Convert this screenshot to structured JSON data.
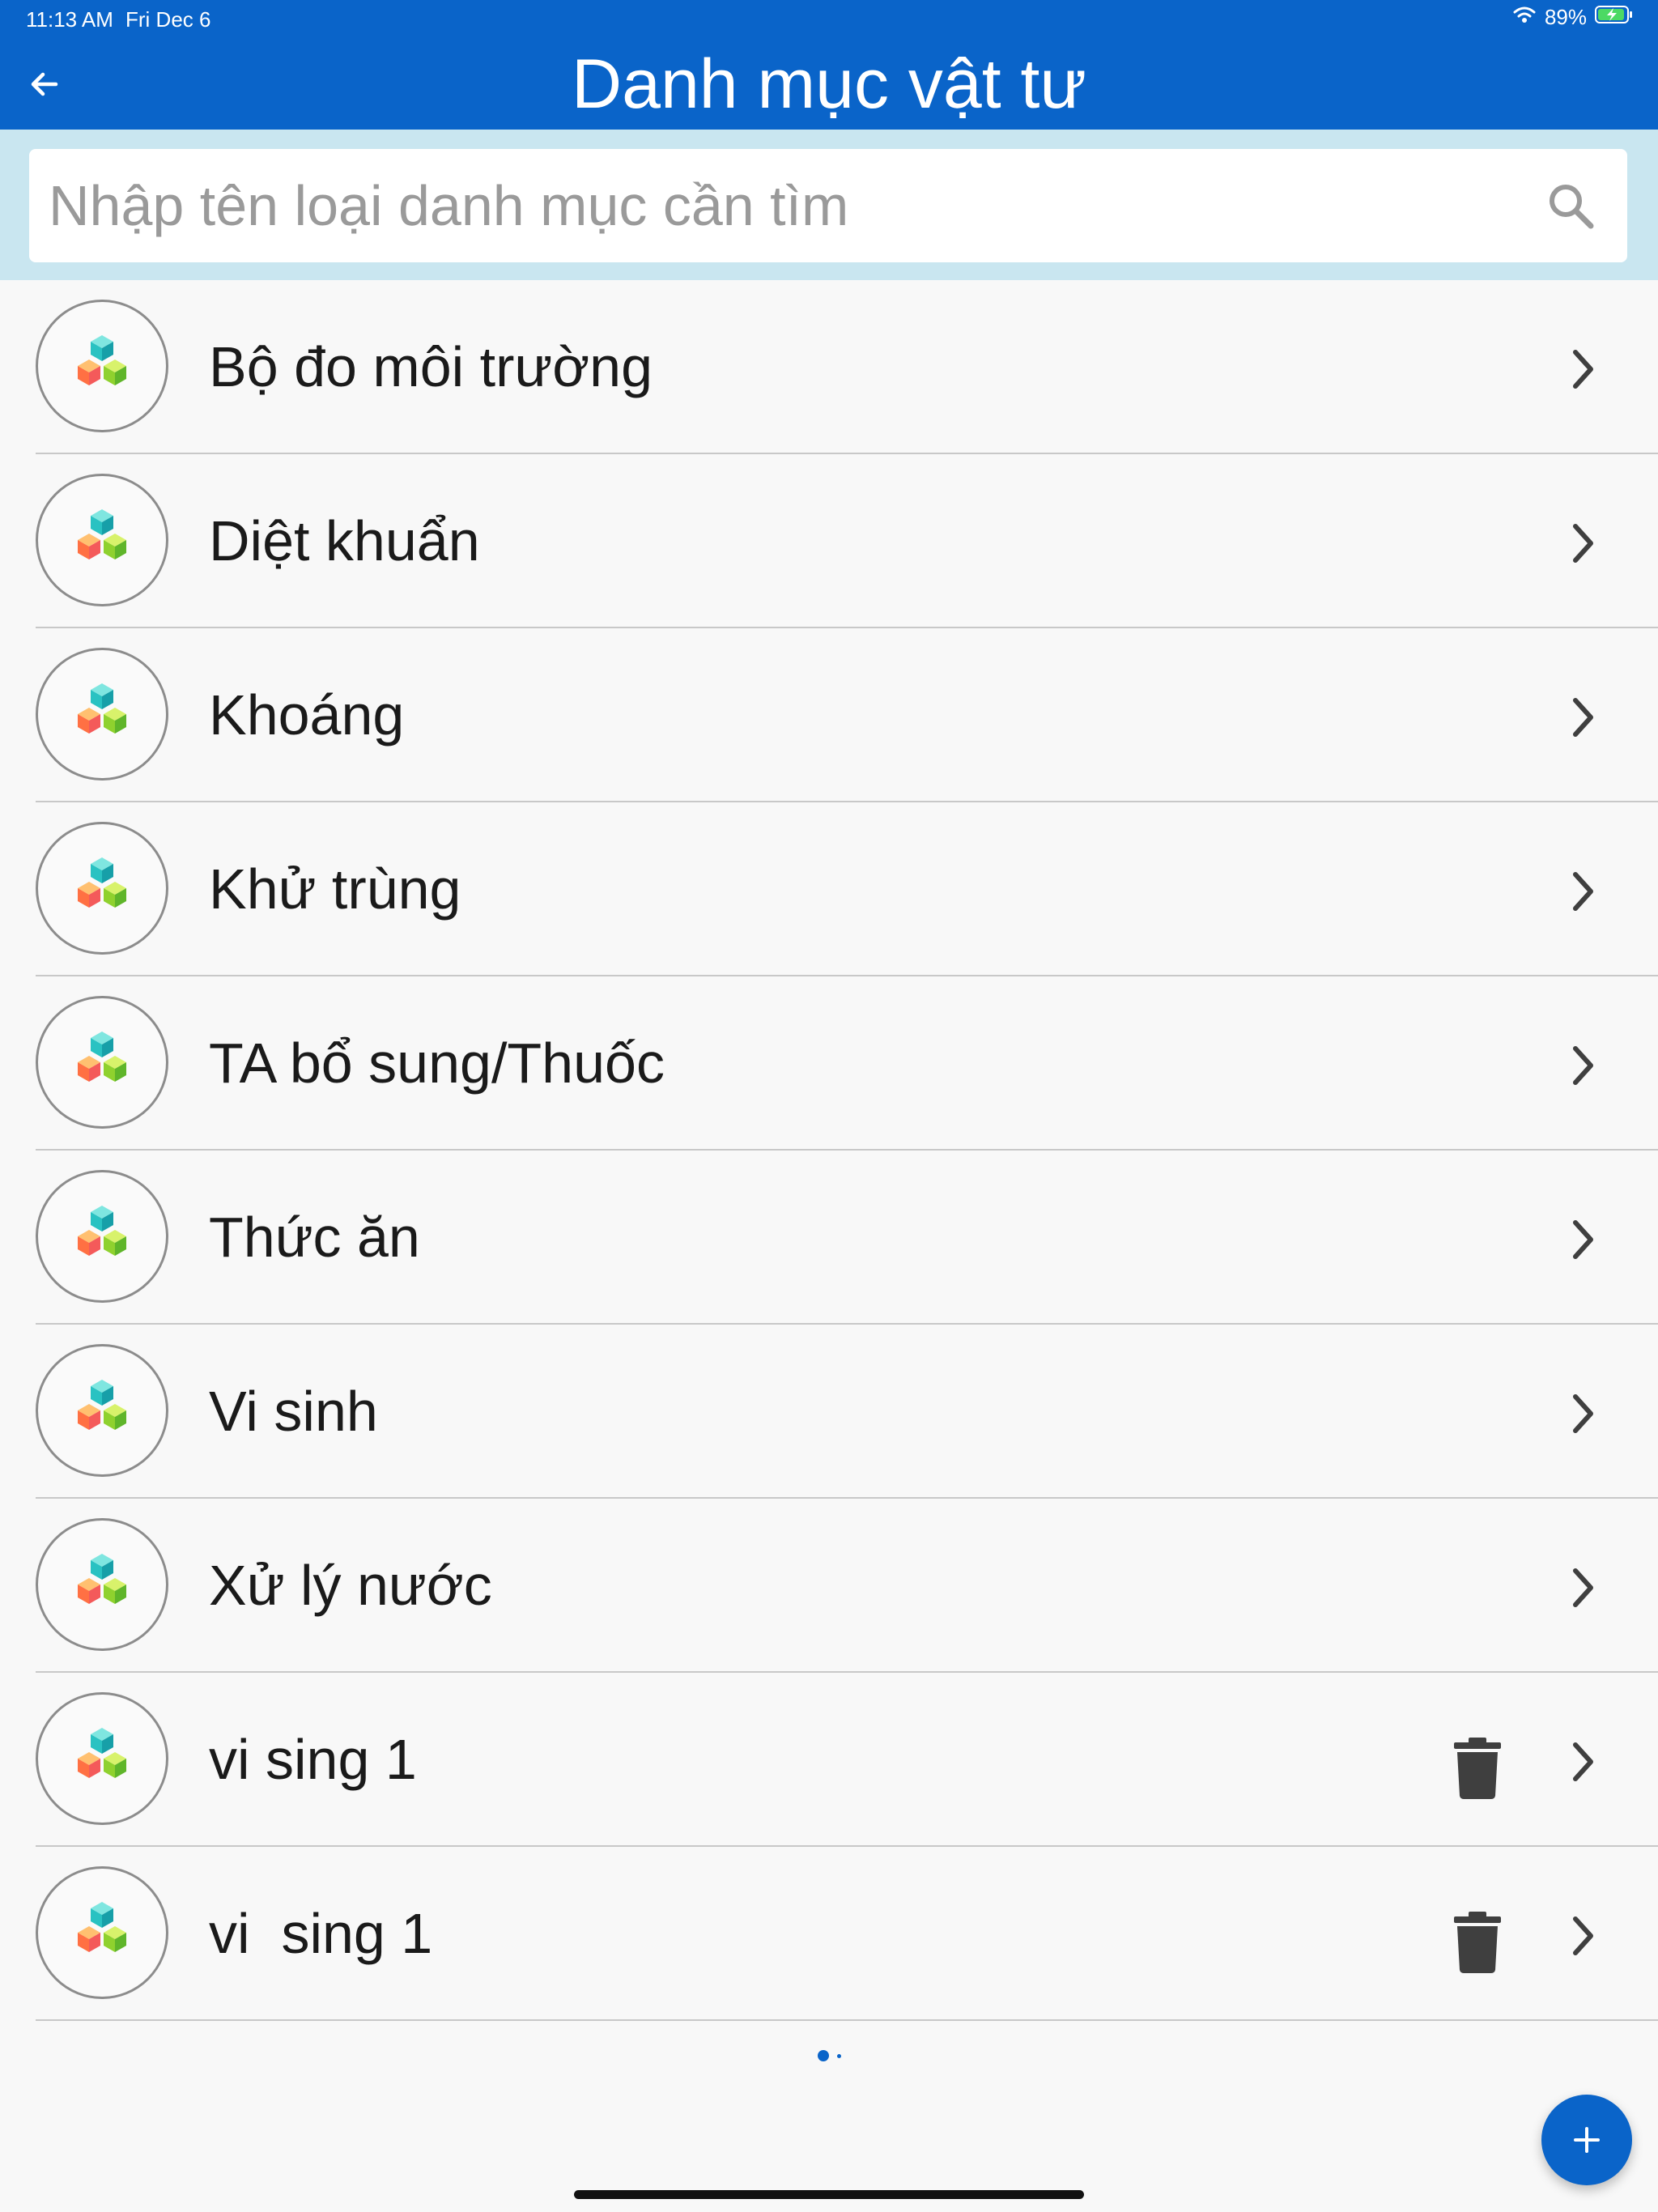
{
  "status_bar": {
    "time": "11:13 AM",
    "date": "Fri Dec 6",
    "battery": "89%",
    "icons": [
      "wifi-icon",
      "battery-charging-icon"
    ]
  },
  "header": {
    "title": "Danh mục vật tư",
    "back_icon": "arrow-left-icon"
  },
  "search": {
    "placeholder": "Nhập tên loại danh mục cần tìm",
    "value": "",
    "icon": "search-icon"
  },
  "items": [
    {
      "label": "Bộ đo môi trường",
      "deletable": false
    },
    {
      "label": "Diệt khuẩn",
      "deletable": false
    },
    {
      "label": "Khoáng",
      "deletable": false
    },
    {
      "label": "Khử trùng",
      "deletable": false
    },
    {
      "label": "TA bổ sung/Thuốc",
      "deletable": false
    },
    {
      "label": "Thức ăn",
      "deletable": false
    },
    {
      "label": "Vi sinh",
      "deletable": false
    },
    {
      "label": "Xử lý nước",
      "deletable": false
    },
    {
      "label": "vi sing 1",
      "deletable": true
    },
    {
      "label": "vi  sing 1",
      "deletable": true
    }
  ],
  "item_icons": {
    "avatar": "cubes-icon",
    "chevron": "chevron-right-icon",
    "delete": "trash-icon"
  },
  "fab": {
    "icon": "plus-icon"
  },
  "colors": {
    "primary": "#0a64c9",
    "search_band": "#c9e6f0",
    "background": "#f8f8f8",
    "text": "#1a1a1a"
  }
}
